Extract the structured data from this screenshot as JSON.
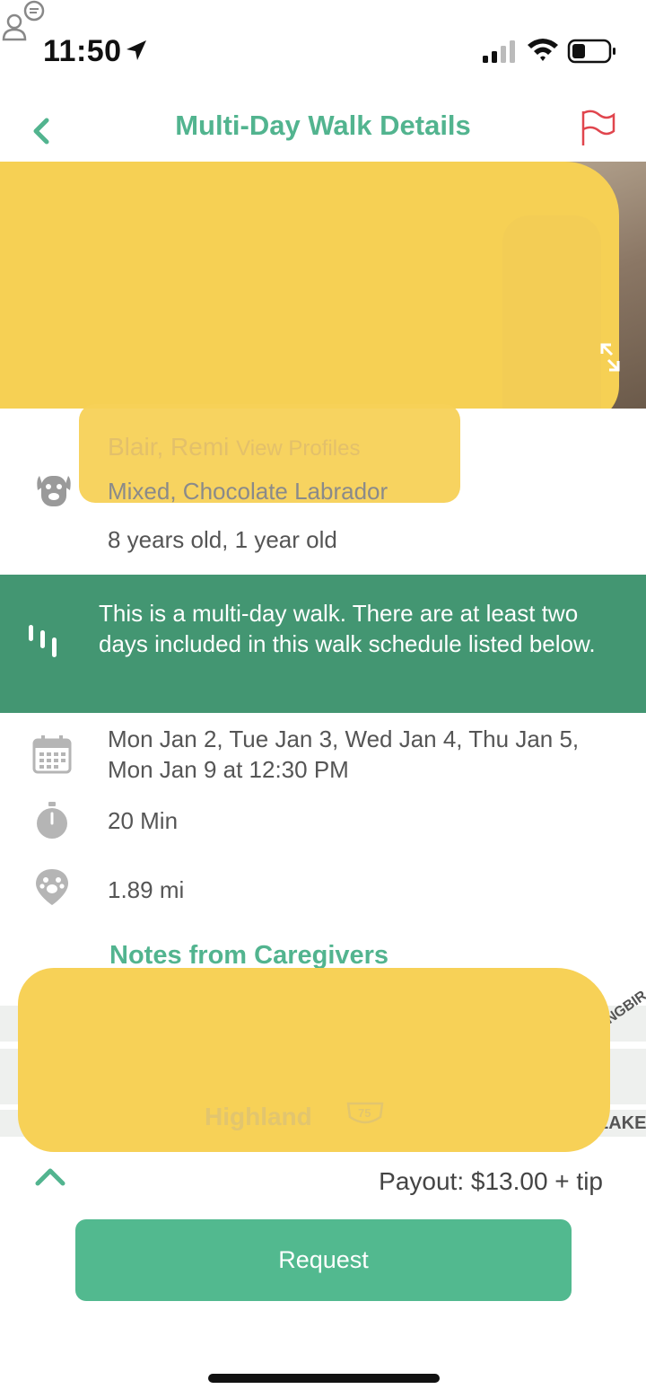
{
  "status_bar": {
    "time": "11:50"
  },
  "header": {
    "title": "Multi-Day Walk Details"
  },
  "dog": {
    "names_redacted": "Blair, Remi",
    "view_profiles_label": "View Profiles",
    "breed": "Mixed, Chocolate Labrador",
    "age": "8 years old, 1 year old"
  },
  "banner": {
    "text": "This is a multi-day walk. There are at least two days included in this walk schedule listed below."
  },
  "details": {
    "schedule": "Mon Jan 2, Tue Jan 3, Wed Jan 4, Thu Jan 5, Mon Jan 9 at 12:30 PM",
    "duration": "20 Min",
    "distance": "1.89 mi",
    "notes_title": "Notes from Caregivers"
  },
  "map": {
    "label_highland": "Highland",
    "route_badge": "75",
    "label_top_right": "NGBIR",
    "label_bottom_right": "LAKE"
  },
  "footer": {
    "payout": "Payout: $13.00 + tip",
    "request_label": "Request"
  },
  "colors": {
    "accent": "#52b48f",
    "banner": "#439672",
    "flag": "#e0454d",
    "redaction": "#f7d157"
  },
  "icons": [
    "location-arrow-icon",
    "signal-icon",
    "wifi-icon",
    "battery-icon",
    "back-chevron-icon",
    "flag-icon",
    "expand-icon",
    "dog-icon",
    "multi-day-icon",
    "calendar-icon",
    "timer-icon",
    "paw-pin-icon",
    "notes-icon",
    "chevron-up-icon"
  ]
}
